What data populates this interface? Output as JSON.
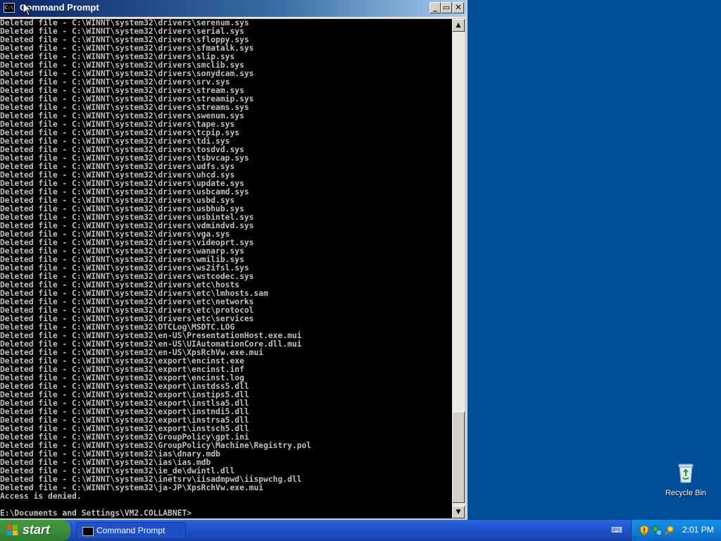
{
  "window": {
    "title": "Command Prompt",
    "icon_text": "C:\\",
    "minimize": "_",
    "maximize": "▭",
    "close": "✕"
  },
  "console": {
    "lines": [
      "Deleted file - C:\\WINNT\\system32\\drivers\\serenum.sys",
      "Deleted file - C:\\WINNT\\system32\\drivers\\serial.sys",
      "Deleted file - C:\\WINNT\\system32\\drivers\\sfloppy.sys",
      "Deleted file - C:\\WINNT\\system32\\drivers\\sfmatalk.sys",
      "Deleted file - C:\\WINNT\\system32\\drivers\\slip.sys",
      "Deleted file - C:\\WINNT\\system32\\drivers\\smclib.sys",
      "Deleted file - C:\\WINNT\\system32\\drivers\\sonydcam.sys",
      "Deleted file - C:\\WINNT\\system32\\drivers\\srv.sys",
      "Deleted file - C:\\WINNT\\system32\\drivers\\stream.sys",
      "Deleted file - C:\\WINNT\\system32\\drivers\\streamip.sys",
      "Deleted file - C:\\WINNT\\system32\\drivers\\streams.sys",
      "Deleted file - C:\\WINNT\\system32\\drivers\\swenum.sys",
      "Deleted file - C:\\WINNT\\system32\\drivers\\tape.sys",
      "Deleted file - C:\\WINNT\\system32\\drivers\\tcpip.sys",
      "Deleted file - C:\\WINNT\\system32\\drivers\\tdi.sys",
      "Deleted file - C:\\WINNT\\system32\\drivers\\tosdvd.sys",
      "Deleted file - C:\\WINNT\\system32\\drivers\\tsbvcap.sys",
      "Deleted file - C:\\WINNT\\system32\\drivers\\udfs.sys",
      "Deleted file - C:\\WINNT\\system32\\drivers\\uhcd.sys",
      "Deleted file - C:\\WINNT\\system32\\drivers\\update.sys",
      "Deleted file - C:\\WINNT\\system32\\drivers\\usbcamd.sys",
      "Deleted file - C:\\WINNT\\system32\\drivers\\usbd.sys",
      "Deleted file - C:\\WINNT\\system32\\drivers\\usbhub.sys",
      "Deleted file - C:\\WINNT\\system32\\drivers\\usbintel.sys",
      "Deleted file - C:\\WINNT\\system32\\drivers\\vdmindvd.sys",
      "Deleted file - C:\\WINNT\\system32\\drivers\\vga.sys",
      "Deleted file - C:\\WINNT\\system32\\drivers\\videoprt.sys",
      "Deleted file - C:\\WINNT\\system32\\drivers\\wanarp.sys",
      "Deleted file - C:\\WINNT\\system32\\drivers\\wmilib.sys",
      "Deleted file - C:\\WINNT\\system32\\drivers\\ws2ifsl.sys",
      "Deleted file - C:\\WINNT\\system32\\drivers\\wstcodec.sys",
      "Deleted file - C:\\WINNT\\system32\\drivers\\etc\\hosts",
      "Deleted file - C:\\WINNT\\system32\\drivers\\etc\\lmhosts.sam",
      "Deleted file - C:\\WINNT\\system32\\drivers\\etc\\networks",
      "Deleted file - C:\\WINNT\\system32\\drivers\\etc\\protocol",
      "Deleted file - C:\\WINNT\\system32\\drivers\\etc\\services",
      "Deleted file - C:\\WINNT\\system32\\DTCLog\\MSDTC.LOG",
      "Deleted file - C:\\WINNT\\system32\\en-US\\PresentationHost.exe.mui",
      "Deleted file - C:\\WINNT\\system32\\en-US\\UIAutomationCore.dll.mui",
      "Deleted file - C:\\WINNT\\system32\\en-US\\XpsRchVw.exe.mui",
      "Deleted file - C:\\WINNT\\system32\\export\\encinst.exe",
      "Deleted file - C:\\WINNT\\system32\\export\\encinst.inf",
      "Deleted file - C:\\WINNT\\system32\\export\\encinst.log",
      "Deleted file - C:\\WINNT\\system32\\export\\instdss5.dll",
      "Deleted file - C:\\WINNT\\system32\\export\\instips5.dll",
      "Deleted file - C:\\WINNT\\system32\\export\\instlsa5.dll",
      "Deleted file - C:\\WINNT\\system32\\export\\instndi5.dll",
      "Deleted file - C:\\WINNT\\system32\\export\\instrsa5.dll",
      "Deleted file - C:\\WINNT\\system32\\export\\instsch5.dll",
      "Deleted file - C:\\WINNT\\system32\\GroupPolicy\\gpt.ini",
      "Deleted file - C:\\WINNT\\system32\\GroupPolicy\\Machine\\Registry.pol",
      "Deleted file - C:\\WINNT\\system32\\ias\\dnary.mdb",
      "Deleted file - C:\\WINNT\\system32\\ias\\ias.mdb",
      "Deleted file - C:\\WINNT\\system32\\ie_de\\dwintl.dll",
      "Deleted file - C:\\WINNT\\system32\\inetsrv\\iisadmpwd\\iispwchg.dll",
      "Deleted file - C:\\WINNT\\system32\\ja-JP\\XpsRchVw.exe.mui",
      "Access is denied."
    ],
    "prompt": "E:\\Documents and Settings\\VM2.COLLABNET>"
  },
  "scrollbar": {
    "up_arrow": "▲",
    "down_arrow": "▼"
  },
  "desktop": {
    "recycle_bin_label": "Recycle Bin"
  },
  "taskbar": {
    "start_label": "start",
    "tasks": [
      {
        "label": "Command Prompt"
      }
    ],
    "keyboard_icon": "⌨",
    "clock": "2:01 PM"
  }
}
